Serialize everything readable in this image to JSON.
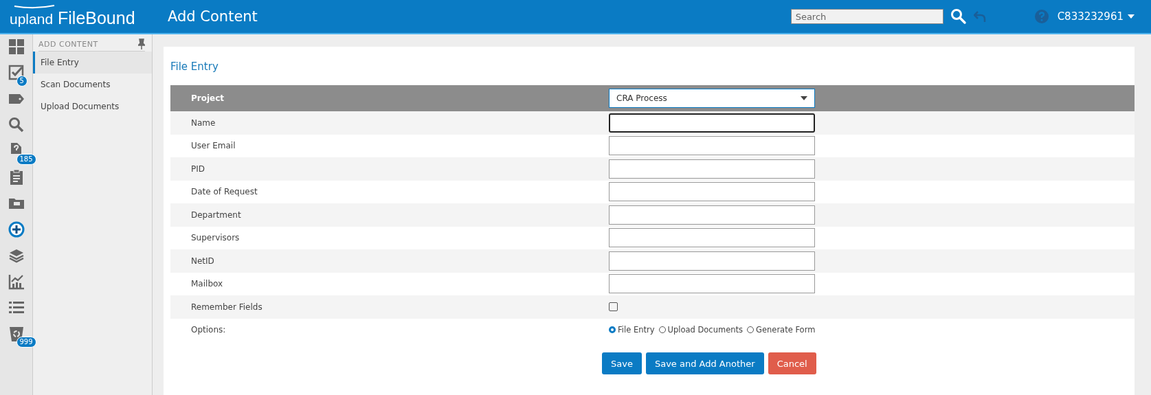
{
  "header": {
    "logo_prefix": "upland",
    "logo_name": "FileBound",
    "title": "Add Content",
    "search": {
      "placeholder": "Search"
    },
    "user": "C833232961"
  },
  "rail": [
    {
      "kind": "dashboard",
      "selected": false
    },
    {
      "kind": "tasks",
      "badge": "5",
      "selected": false
    },
    {
      "kind": "tag",
      "selected": false
    },
    {
      "kind": "search",
      "selected": false
    },
    {
      "kind": "unknown-doc",
      "badge": "185",
      "selected": false
    },
    {
      "kind": "clipboard",
      "selected": false
    },
    {
      "kind": "folder",
      "selected": false
    },
    {
      "kind": "add",
      "selected": true
    },
    {
      "kind": "layers",
      "selected": false
    },
    {
      "kind": "chart",
      "selected": false
    },
    {
      "kind": "list",
      "selected": false
    },
    {
      "kind": "recycle",
      "badge": "999",
      "selected": false
    }
  ],
  "panel": {
    "heading": "ADD CONTENT",
    "items": [
      {
        "label": "File Entry",
        "selected": true
      },
      {
        "label": "Scan Documents",
        "selected": false
      },
      {
        "label": "Upload Documents",
        "selected": false
      }
    ]
  },
  "form": {
    "title": "File Entry",
    "project": {
      "label": "Project",
      "value": "CRA Process"
    },
    "fields": [
      {
        "label": "Name",
        "focused": true
      },
      {
        "label": "User Email",
        "focused": false
      },
      {
        "label": "PID",
        "focused": false
      },
      {
        "label": "Date of Request",
        "focused": false
      },
      {
        "label": "Department",
        "focused": false
      },
      {
        "label": "Supervisors",
        "focused": false
      },
      {
        "label": "NetID",
        "focused": false
      },
      {
        "label": "Mailbox",
        "focused": false
      }
    ],
    "remember": {
      "label": "Remember Fields",
      "checked": false
    },
    "options": {
      "label": "Options:",
      "choices": [
        {
          "label": "File Entry",
          "selected": true
        },
        {
          "label": "Upload Documents",
          "selected": false
        },
        {
          "label": "Generate Form",
          "selected": false
        }
      ]
    }
  },
  "buttons": [
    {
      "label": "Save",
      "kind": "primary"
    },
    {
      "label": "Save and Add Another",
      "kind": "primary"
    },
    {
      "label": "Cancel",
      "kind": "danger"
    }
  ]
}
